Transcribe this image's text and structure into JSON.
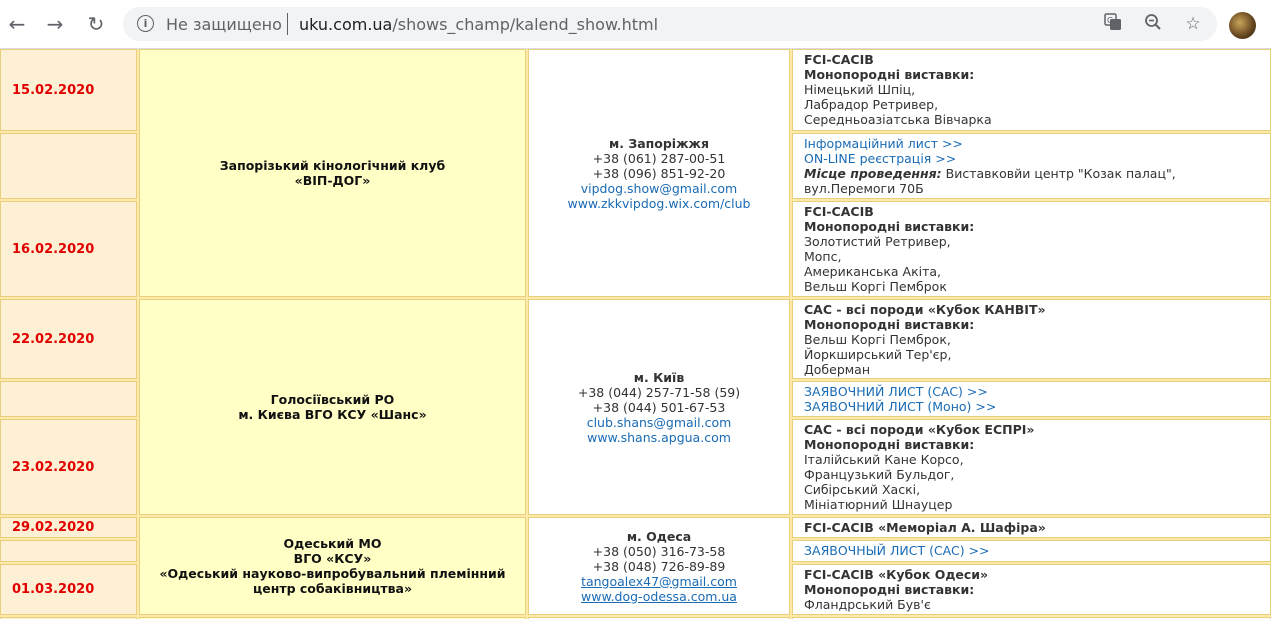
{
  "browser": {
    "security_label": "Не защищено",
    "url_host": "uku.com.ua",
    "url_path": "/shows_champ/kalend_show.html"
  },
  "events": [
    {
      "dates": [
        "15.02.2020",
        "16.02.2020"
      ],
      "club": [
        "Запорізький кінологічний клуб",
        "«ВІП-ДОГ»"
      ],
      "contact": {
        "city": "м. Запоріжжя",
        "phones": [
          "+38 (061) 287-00-51",
          "+38 (096) 851-92-20"
        ],
        "email": "vipdog.show@gmail.com",
        "site": "www.zkkvipdog.wix.com/club"
      },
      "show1": {
        "title": "FCI-CACIB",
        "mono_label": "Монопородні виставки",
        "breeds": [
          "Німецький Шпіц,",
          "Лабрадор Ретривер,",
          "Середньоазіатська Вівчарка"
        ]
      },
      "links": [
        "Інформаційний лист >>",
        "ON-LINE реєстрація >>"
      ],
      "venue_label": "Місце проведення:",
      "venue": "Виставковйи центр \"Козак палац\", вул.Перемоги 70Б",
      "show2": {
        "title": "FCI-CACIB",
        "mono_label": "Монопородні виставки",
        "breeds": [
          "Золотистий Ретривер,",
          "Мопс,",
          "Американська Акіта,",
          "Вельш Коргі Пемброк"
        ]
      }
    },
    {
      "dates": [
        "22.02.2020",
        "23.02.2020"
      ],
      "club": [
        "Голосіївський РО",
        "м. Києва ВГО КСУ «Шанс»"
      ],
      "contact": {
        "city": "м. Київ",
        "phones": [
          "+38 (044) 257-71-58 (59)",
          "+38 (044) 501-67-53"
        ],
        "email": "club.shans@gmail.com",
        "site": "www.shans.apgua.com"
      },
      "show1": {
        "title": "CAC - всі породи «Кубок КАНВІТ»",
        "mono_label": "Монопородні виставки:",
        "breeds": [
          "Вельш Коргі Пемброк,",
          "Йоркширський Тер'єр,",
          "Доберман"
        ]
      },
      "links": [
        "ЗАЯВОЧНИЙ ЛИСТ (CAC) >>",
        "ЗАЯВОЧНИЙ ЛИСТ (Моно) >>"
      ],
      "show2": {
        "title": "CAC - всі породи «Кубок ЕСПРІ»",
        "mono_label": "Монопородні виставки:",
        "breeds": [
          "Італійський Кане Корсо,",
          "Французький Бульдог,",
          "Сибірський Хаскі,",
          "Мініатюрний Шнауцер"
        ]
      }
    },
    {
      "dates": [
        "29.02.2020",
        "01.03.2020"
      ],
      "club": [
        "Одеський МО",
        "ВГО «КСУ»",
        "«Одеський науково-випробувальний племінний",
        "центр собаківництва»"
      ],
      "contact": {
        "city": "м. Одеса",
        "phones": [
          "+38 (050) 316-73-58",
          "+38 (048) 726-89-89"
        ],
        "email": "tangoalex47@gmail.com",
        "site": "www.dog-odessa.com.ua"
      },
      "show1": {
        "title": "FCI-CACIB «Меморіал А. Шафіра»"
      },
      "links": [
        "ЗАЯВОЧНЫЙ ЛИСТ (CAC) >>"
      ],
      "show2": {
        "title": "FCI-CACIB «Кубок Одеси»",
        "mono_label": "Монопородні виставки:",
        "breeds": [
          "Фландрський Був'є"
        ]
      }
    }
  ]
}
